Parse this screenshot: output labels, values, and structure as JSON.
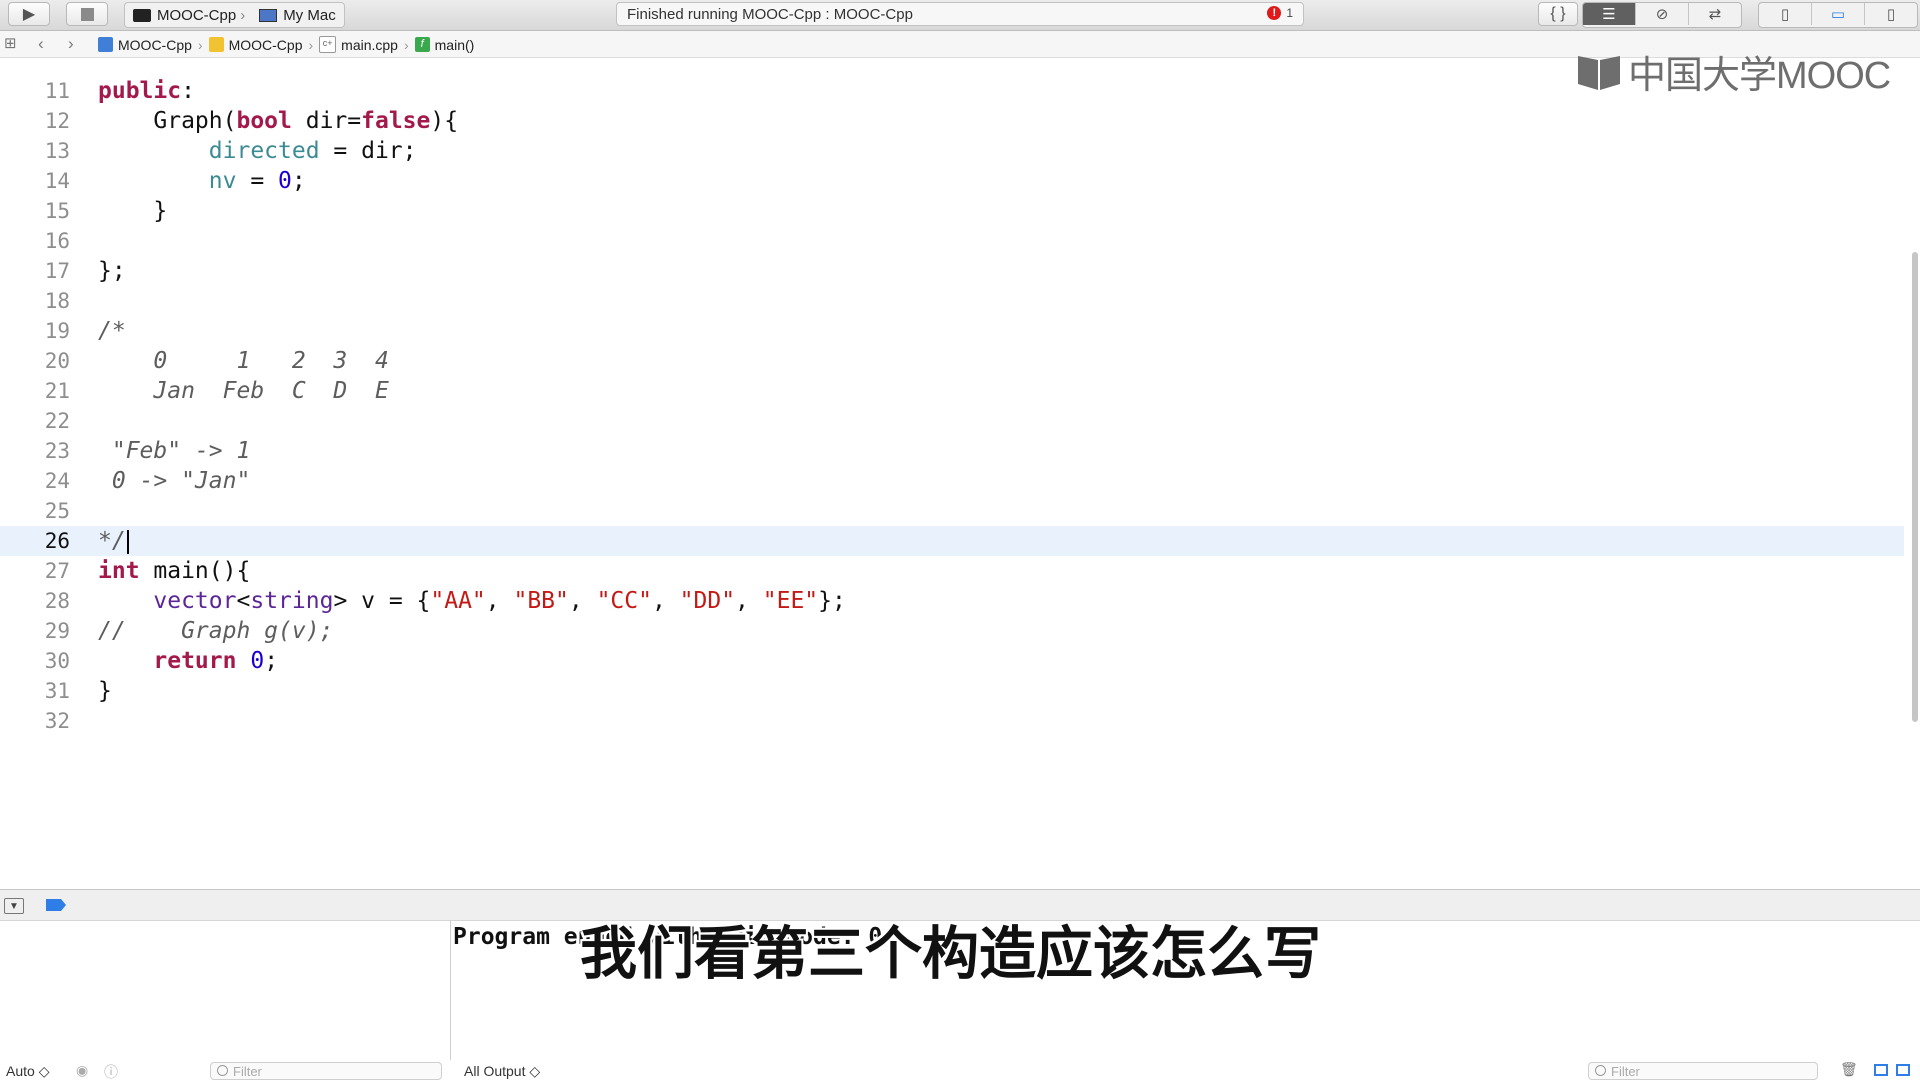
{
  "toolbar": {
    "scheme_target": "MOOC-Cpp",
    "scheme_device": "My Mac",
    "status_text": "Finished running MOOC-Cpp : MOOC-Cpp",
    "error_count": "1",
    "run_icon": "play-icon",
    "stop_icon": "stop-icon"
  },
  "jumpbar": {
    "crumbs": [
      "MOOC-Cpp",
      "MOOC-Cpp",
      "main.cpp",
      "main()"
    ]
  },
  "watermark": "中国大学MOOC",
  "editor": {
    "current_line": 26,
    "lines": [
      {
        "n": "11",
        "text": "public:"
      },
      {
        "n": "12",
        "text": "    Graph(bool dir=false){"
      },
      {
        "n": "13",
        "text": "        directed = dir;"
      },
      {
        "n": "14",
        "text": "        nv = 0;"
      },
      {
        "n": "15",
        "text": "    }"
      },
      {
        "n": "16",
        "text": ""
      },
      {
        "n": "17",
        "text": "};"
      },
      {
        "n": "18",
        "text": ""
      },
      {
        "n": "19",
        "text": "/*"
      },
      {
        "n": "20",
        "text": "    0     1   2  3  4"
      },
      {
        "n": "21",
        "text": "    Jan  Feb  C  D  E"
      },
      {
        "n": "22",
        "text": ""
      },
      {
        "n": "23",
        "text": " \"Feb\" -> 1"
      },
      {
        "n": "24",
        "text": " 0 -> \"Jan\""
      },
      {
        "n": "25",
        "text": ""
      },
      {
        "n": "26",
        "text": "*/"
      },
      {
        "n": "27",
        "text": "int main(){"
      },
      {
        "n": "28",
        "text": "    vector<string> v = {\"AA\", \"BB\", \"CC\", \"DD\", \"EE\"};"
      },
      {
        "n": "29",
        "text": "//    Graph g(v);"
      },
      {
        "n": "30",
        "text": "    return 0;"
      },
      {
        "n": "31",
        "text": "}"
      },
      {
        "n": "32",
        "text": ""
      }
    ]
  },
  "console": {
    "text": "Program ended with exit code: 0"
  },
  "subtitle": "我们看第三个构造应该怎么写",
  "bottom": {
    "auto_label": "Auto ◇",
    "filter_placeholder": "Filter",
    "output_label": "All Output ◇",
    "console_filter_placeholder": "Filter"
  },
  "colors": {
    "keyword": "#a4194b",
    "type": "#5c2699",
    "ivar": "#3c8b94",
    "number": "#1c00cf",
    "string": "#c41a16",
    "comment": "#5d5d5d",
    "current_line_bg": "#e9f2fc"
  }
}
